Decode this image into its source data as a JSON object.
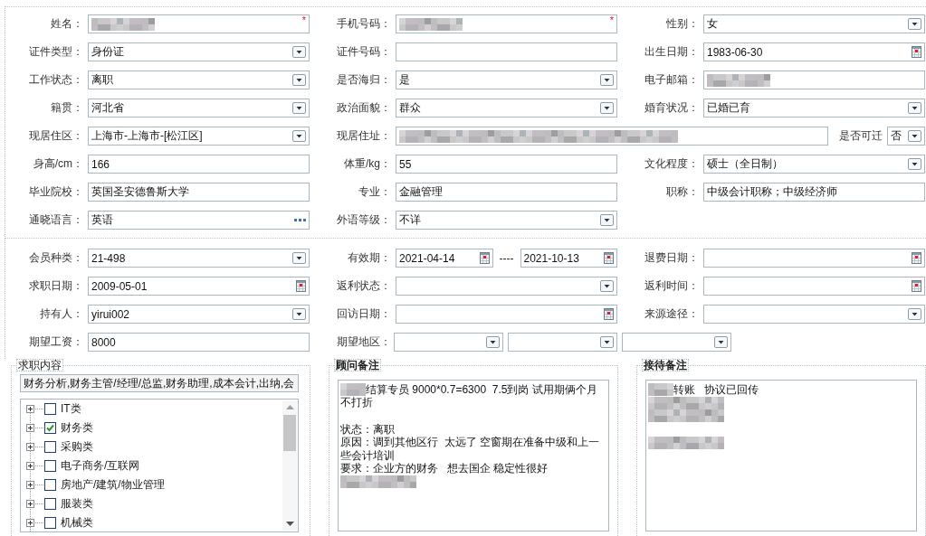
{
  "personal": {
    "rows": [
      [
        {
          "label": "姓名：",
          "kind": "text",
          "redacted": true,
          "marker": "*"
        },
        {
          "label": "手机号码：",
          "kind": "text",
          "redacted": true,
          "marker": "*"
        },
        {
          "label": "性别：",
          "kind": "select",
          "redacted": false,
          "value": "女"
        }
      ],
      [
        {
          "label": "证件类型：",
          "kind": "select",
          "redacted": false,
          "value": "身份证"
        },
        {
          "label": "证件号码：",
          "kind": "text",
          "redacted": false
        },
        {
          "label": "出生日期：",
          "kind": "date",
          "redacted": false,
          "value": "1983-06-30"
        }
      ],
      [
        {
          "label": "工作状态：",
          "kind": "select",
          "redacted": false,
          "value": "离职"
        },
        {
          "label": "是否海归：",
          "kind": "select",
          "redacted": false,
          "value": "是"
        },
        {
          "label": "电子邮箱：",
          "kind": "text",
          "redacted": true
        }
      ],
      [
        {
          "label": "籍贯：",
          "kind": "select",
          "redacted": false,
          "value": "河北省"
        },
        {
          "label": "政治面貌：",
          "kind": "select",
          "redacted": false,
          "value": "群众"
        },
        {
          "label": "婚育状况：",
          "kind": "select",
          "redacted": false,
          "value": "已婚已育"
        }
      ],
      [
        {
          "label": "现居住区：",
          "kind": "select",
          "redacted": false,
          "value": "上海市-上海市-[松江区]"
        },
        {
          "label": "现居住址：",
          "kind": "text",
          "redacted": true,
          "inline_field": {
            "label": "是否可迁",
            "kind": "select",
            "value": "否"
          }
        }
      ],
      [
        {
          "label": "身高/cm：",
          "kind": "text",
          "redacted": false,
          "value": "166"
        },
        {
          "label": "体重/kg：",
          "kind": "text",
          "redacted": false,
          "value": "55"
        },
        {
          "label": "文化程度：",
          "kind": "select",
          "redacted": false,
          "value": "硕士（全日制）"
        }
      ],
      [
        {
          "label": "毕业院校：",
          "kind": "text",
          "redacted": false,
          "value": "英国圣安德鲁斯大学"
        },
        {
          "label": "专业：",
          "kind": "text",
          "redacted": false,
          "value": "金融管理"
        },
        {
          "label": "职称：",
          "kind": "text",
          "redacted": false,
          "value": "中级会计职称；中级经济师"
        }
      ],
      [
        {
          "label": "通晓语言：",
          "kind": "picker",
          "redacted": false,
          "value": "英语"
        },
        {
          "label": "外语等级：",
          "kind": "select",
          "redacted": false,
          "value": "不详"
        }
      ]
    ]
  },
  "membership": {
    "rows": [
      [
        {
          "label": "会员种类：",
          "kind": "select",
          "value": "21-498"
        },
        {
          "label": "有效期：",
          "kind": "group",
          "controls": [
            {
              "kind": "date",
              "value": "2021-04-14"
            },
            {
              "kind": "separator",
              "text": "----"
            },
            {
              "kind": "date",
              "value": "2021-10-13"
            }
          ]
        },
        {
          "label": "退费日期：",
          "kind": "date"
        }
      ],
      [
        {
          "label": "求职日期：",
          "kind": "date",
          "value": "2009-05-01"
        },
        {
          "label": "返利状态：",
          "kind": "select"
        },
        {
          "label": "返利时间：",
          "kind": "date"
        }
      ],
      [
        {
          "label": "持有人：",
          "kind": "select",
          "value": "yirui002"
        },
        {
          "label": "回访日期：",
          "kind": "date"
        },
        {
          "label": "来源途径：",
          "kind": "select"
        }
      ],
      [
        {
          "label": "期望工资：",
          "kind": "text",
          "value": "8000"
        },
        {
          "label": "期望地区：",
          "kind": "group",
          "controls": [
            {
              "kind": "select"
            },
            {
              "kind": "select"
            },
            {
              "kind": "select"
            }
          ]
        }
      ]
    ]
  },
  "job_content": {
    "title": "求职内容",
    "summary": "财务分析,财务主管/经理/总监,财务助理,成本会计,出纳,会",
    "tree": [
      {
        "label": "IT类",
        "checked": false,
        "expanded": false
      },
      {
        "label": "财务类",
        "checked": true,
        "expanded": false
      },
      {
        "label": "采购类",
        "checked": false,
        "expanded": false
      },
      {
        "label": "电子商务/互联网",
        "checked": false,
        "expanded": false
      },
      {
        "label": "房地产/建筑/物业管理",
        "checked": false,
        "expanded": false
      },
      {
        "label": "服装类",
        "checked": false,
        "expanded": false
      },
      {
        "label": "机械类",
        "checked": false,
        "expanded": false
      }
    ]
  },
  "advisor_notes": {
    "title": "顾问备注",
    "paragraphs": [
      [
        {
          "redacted": true,
          "text": "结算专员 9000*0.7=6300  7.5到岗 试用期俩个月"
        },
        {
          "redacted": false,
          "text": "不打折"
        }
      ],
      [
        {
          "redacted": false,
          "text": "状态：离职"
        },
        {
          "redacted": false,
          "text": "原因：调到其他区行  太远了 空窗期在准备中级和上一"
        },
        {
          "redacted": false,
          "text": "些会计培训"
        },
        {
          "redacted": false,
          "text": "要求：企业方的财务   想去国企 稳定性很好"
        },
        {
          "redacted": true
        }
      ]
    ]
  },
  "reception_notes": {
    "title": "接待备注",
    "paragraphs": [
      [
        {
          "redacted": true,
          "text": "转账   协议已回传"
        },
        {
          "redacted": true
        },
        {
          "redacted": true
        }
      ],
      [
        {
          "redacted": true
        }
      ]
    ]
  }
}
